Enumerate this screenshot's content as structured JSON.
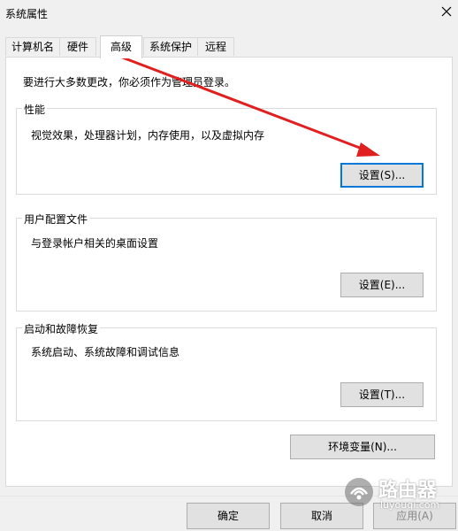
{
  "window": {
    "title": "系统属性",
    "close_icon": "close-icon"
  },
  "tabs": [
    {
      "label": "计算机名"
    },
    {
      "label": "硬件"
    },
    {
      "label": "高级",
      "active": true
    },
    {
      "label": "系统保护"
    },
    {
      "label": "远程"
    }
  ],
  "intro": "要进行大多数更改，你必须作为管理员登录。",
  "groups": {
    "performance": {
      "title": "性能",
      "desc": "视觉效果，处理器计划，内存使用，以及虚拟内存",
      "button": "设置(S)..."
    },
    "profile": {
      "title": "用户配置文件",
      "desc": "与登录帐户相关的桌面设置",
      "button": "设置(E)..."
    },
    "startup": {
      "title": "启动和故障恢复",
      "desc": "系统启动、系统故障和调试信息",
      "button": "设置(T)..."
    }
  },
  "env_button": "环境变量(N)...",
  "footer": {
    "ok": "确定",
    "cancel": "取消",
    "apply": "应用(A)"
  },
  "watermark": {
    "name": "路由器",
    "site": "luyouqi.com"
  },
  "annotation": {
    "arrow_color": "#e02020"
  }
}
